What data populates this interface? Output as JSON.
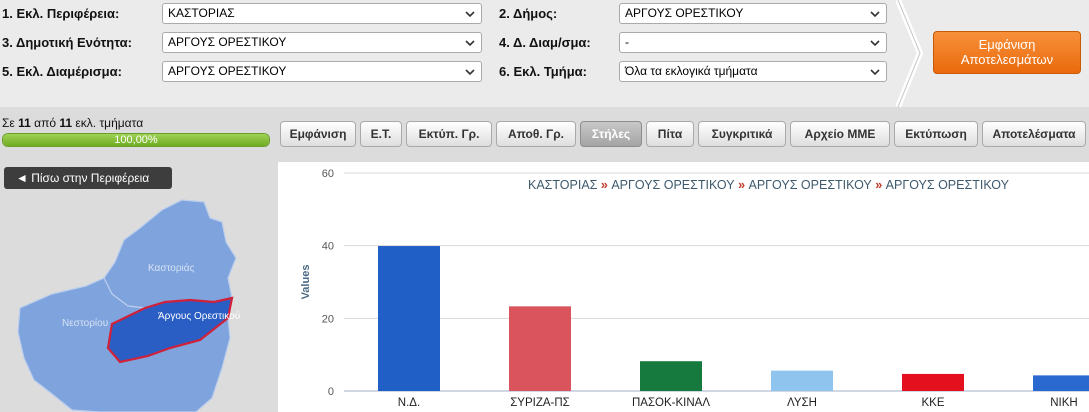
{
  "filters": {
    "region": {
      "label": "1. Εκλ. Περιφέρεια:",
      "value": "ΚΑΣΤΟΡΙΑΣ"
    },
    "municipality": {
      "label": "2. Δήμος:",
      "value": "ΑΡΓΟΥΣ ΟΡΕΣΤΙΚΟΥ"
    },
    "municipal_unit": {
      "label": "3. Δημοτική Ενότητα:",
      "value": "ΑΡΓΟΥΣ ΟΡΕΣΤΙΚΟΥ"
    },
    "district": {
      "label": "4. Δ. Διαμ/σμα:",
      "value": "-"
    },
    "electoral_district": {
      "label": "5. Εκλ. Διαμέρισμα:",
      "value": "ΑΡΓΟΥΣ ΟΡΕΣΤΙΚΟΥ"
    },
    "section": {
      "label": "6. Εκλ. Τμήμα:",
      "value": "Όλα τα εκλογικά τμήματα"
    },
    "show_results_line1": "Εμφάνιση",
    "show_results_line2": "Αποτελεσμάτων"
  },
  "progress": {
    "prefix": "Σε",
    "done": "11",
    "middle": "από",
    "total": "11",
    "suffix": "εκλ. τμήματα",
    "percent_label": "100,00%",
    "fraction": 1.0
  },
  "tabs": [
    {
      "id": "show",
      "label": "Εμφάνιση",
      "active": false
    },
    {
      "id": "et",
      "label": "Ε.Τ.",
      "active": false
    },
    {
      "id": "print-gr",
      "label": "Εκτύπ. Γρ.",
      "active": false
    },
    {
      "id": "save-gr",
      "label": "Αποθ. Γρ.",
      "active": false
    },
    {
      "id": "columns",
      "label": "Στήλες",
      "active": true
    },
    {
      "id": "pie",
      "label": "Πίτα",
      "active": false
    },
    {
      "id": "compare",
      "label": "Συγκριτικά",
      "active": false
    },
    {
      "id": "media",
      "label": "Αρχείο ΜΜΕ",
      "active": false
    },
    {
      "id": "print",
      "label": "Εκτύπωση",
      "active": false
    },
    {
      "id": "results",
      "label": "Αποτελέσματα",
      "active": false
    }
  ],
  "back_button_label": "◄ Πίσω στην Περιφέρεια",
  "map": {
    "labels": {
      "kastoria": "Καστοριάς",
      "argos": "Άργους Ορεστικού",
      "nestorio": "Νεστορίου"
    },
    "colors": {
      "base": "#7fa3dc",
      "highlight": "#2a5ec4",
      "border": "#d0213a"
    }
  },
  "breadcrumb": [
    "ΚΑΣΤΟΡΙΑΣ",
    "ΑΡΓΟΥΣ ΟΡΕΣΤΙΚΟΥ",
    "ΑΡΓΟΥΣ ΟΡΕΣΤΙΚΟΥ",
    "ΑΡΓΟΥΣ ΟΡΕΣΤΙΚΟΥ"
  ],
  "breadcrumb_separator": "»",
  "chart_data": {
    "type": "bar",
    "title": "",
    "xlabel": "",
    "ylabel": "Values",
    "ylim": [
      0,
      60
    ],
    "yticks": [
      0,
      20,
      40,
      60
    ],
    "grid": true,
    "categories": [
      "Ν.Δ.",
      "ΣΥΡΙΖΑ-ΠΣ",
      "ΠΑΣΟΚ-ΚΙΝΑΛ",
      "ΛΥΣΗ",
      "ΚΚΕ",
      "ΝΙΚΗ"
    ],
    "values": [
      39.9,
      23.3,
      8.2,
      5.6,
      4.7,
      4.3
    ],
    "colors": [
      "#1f5fc6",
      "#d9545c",
      "#167a3e",
      "#8ec4ee",
      "#e4101e",
      "#2a6ad0"
    ]
  }
}
